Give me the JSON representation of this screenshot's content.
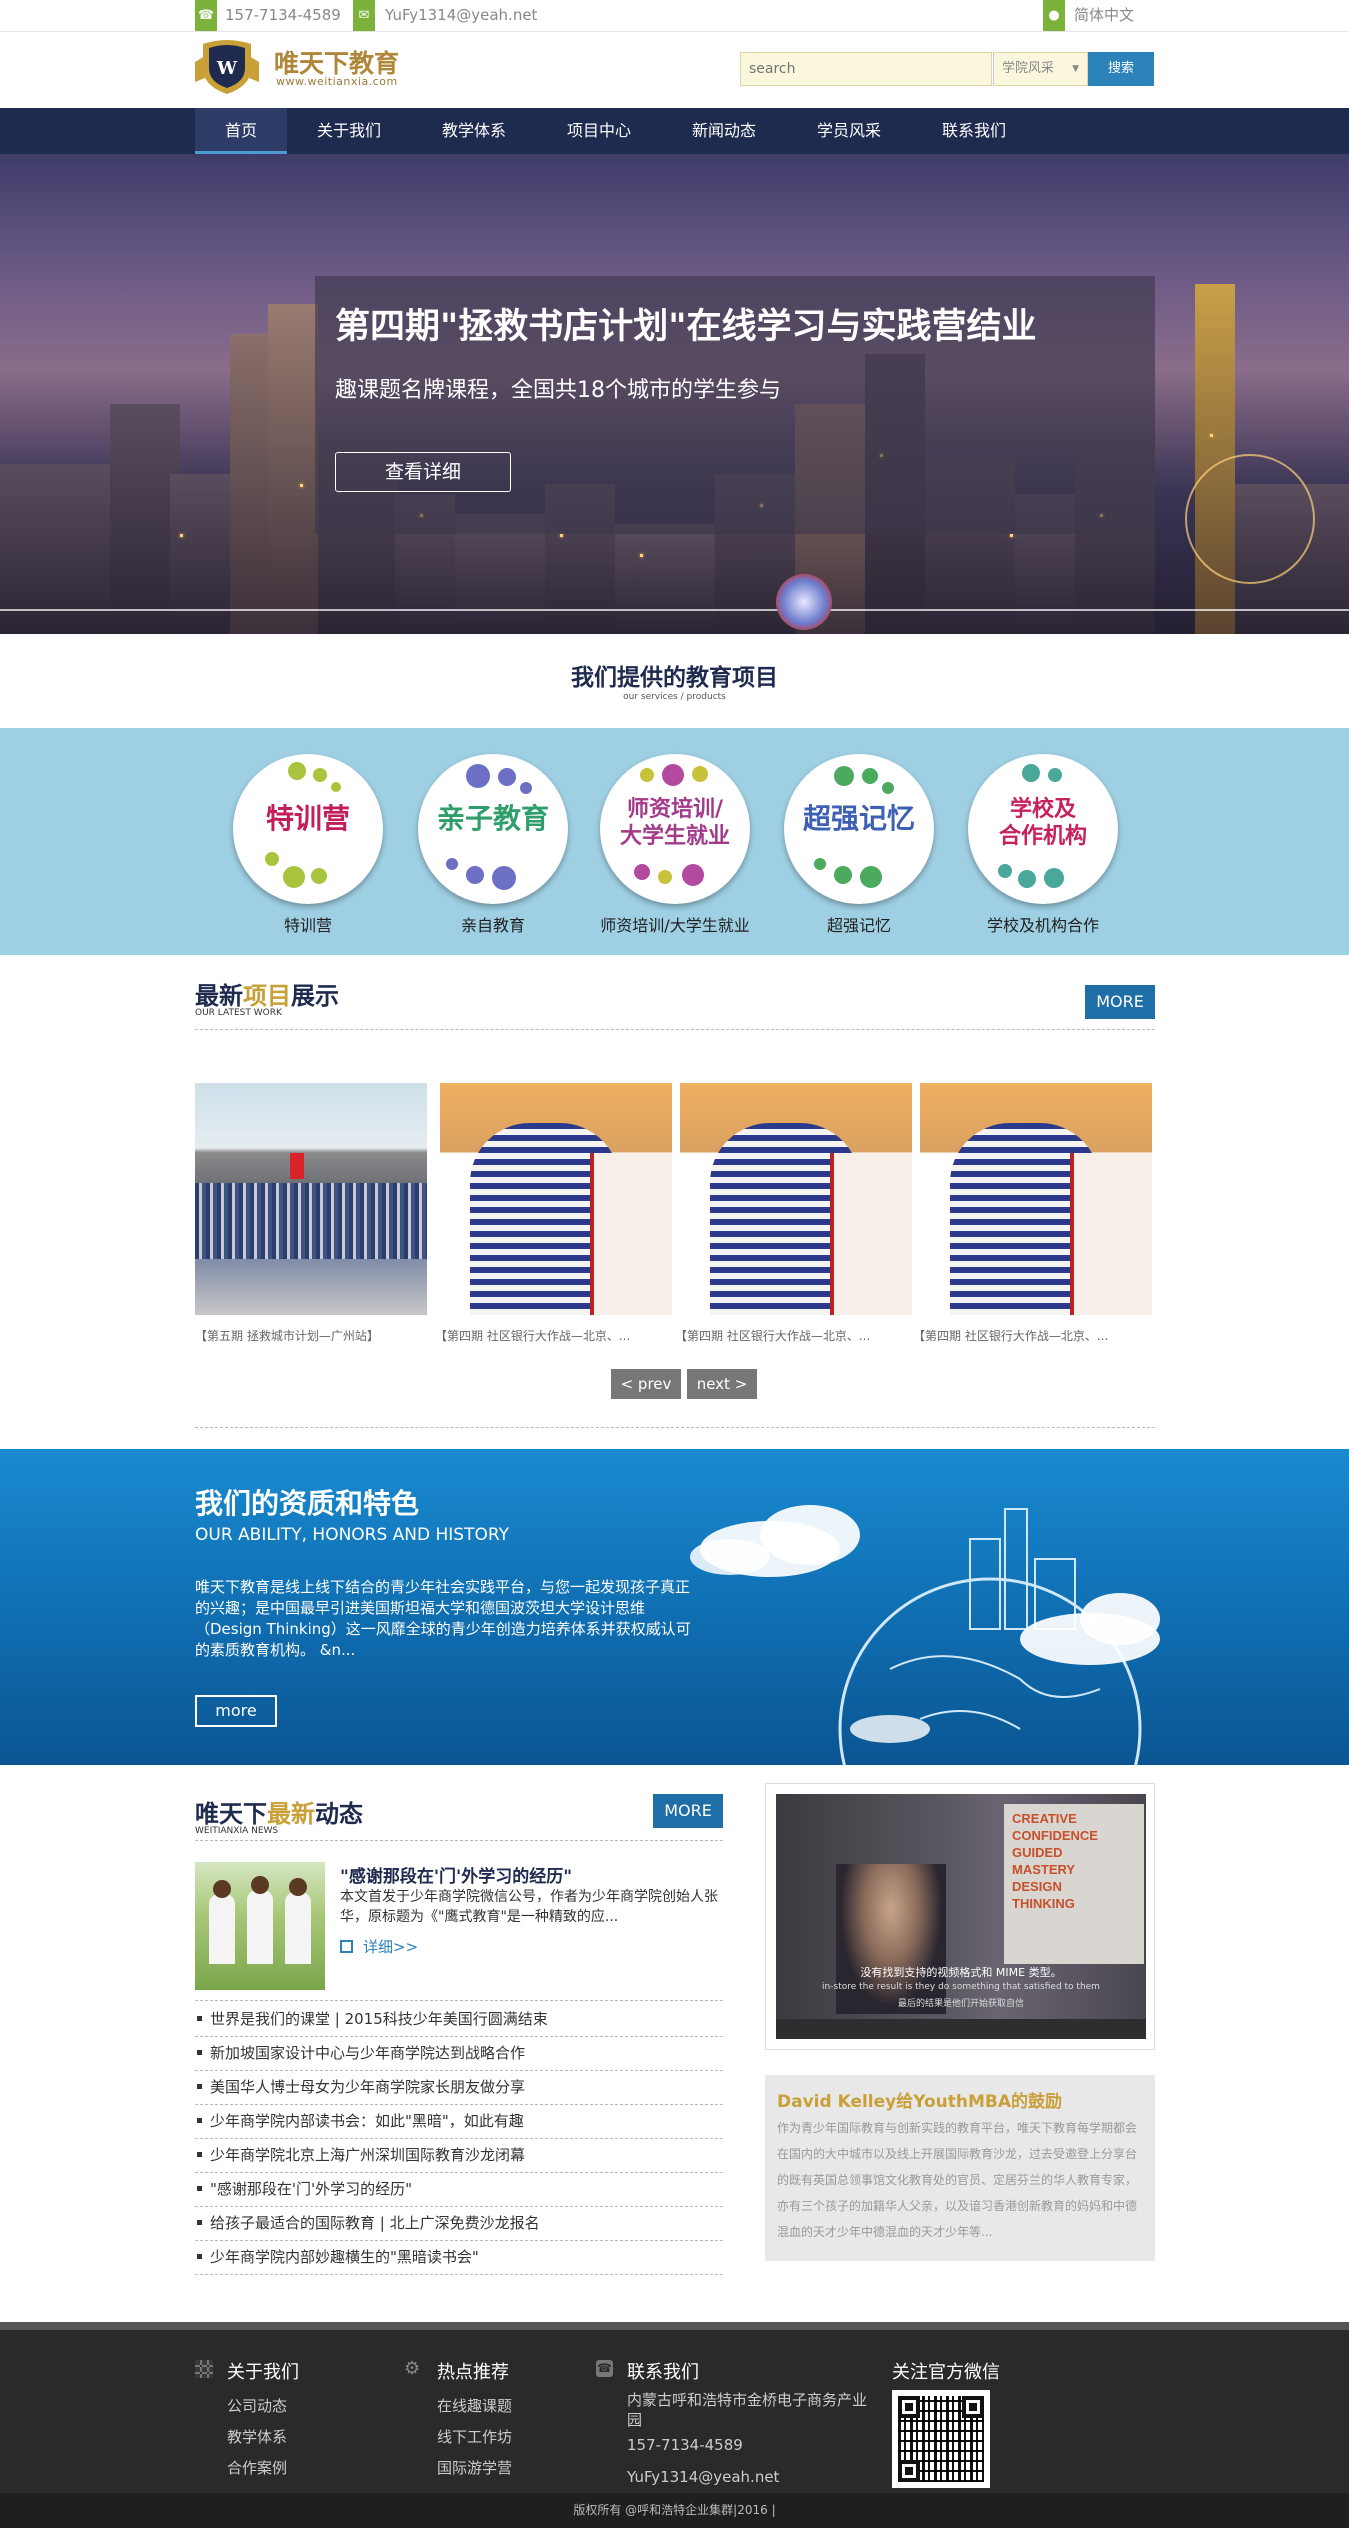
{
  "topbar": {
    "phone": "157-7134-4589",
    "email": "YuFy1314@yeah.net",
    "language": "简体中文"
  },
  "header": {
    "logo_title": "唯天下教育",
    "logo_url": "www.weitianxia.com",
    "search_placeholder": "search",
    "search_select": "学院风采",
    "search_button": "搜索"
  },
  "nav": {
    "items": [
      "首页",
      "关于我们",
      "教学体系",
      "项目中心",
      "新闻动态",
      "学员风采",
      "联系我们"
    ]
  },
  "banner": {
    "title": "第四期\"拯救书店计划\"在线学习与实践营结业",
    "subtitle": "趣课题名牌课程，全国共18个城市的学生参与",
    "button": "查看详细"
  },
  "services": {
    "title": "我们提供的教育项目",
    "subtitle": "our services / products",
    "items": [
      {
        "word": "特训营",
        "label": "特训营",
        "color": "#c21f5a",
        "dots": "#a8c43c"
      },
      {
        "word": "亲子教育",
        "label": "亲自教育",
        "color": "#2f9e6a",
        "dots": "#6c6fc4"
      },
      {
        "word1": "师资培训/",
        "word2": "大学生就业",
        "label": "师资培训/大学生就业",
        "color": "#a43a8a",
        "dots": "#b44aa0",
        "dots2": "#c8c23a"
      },
      {
        "word": "超强记忆",
        "label": "超强记忆",
        "color": "#3d5fb4",
        "dots": "#4caa5e"
      },
      {
        "word1": "学校及",
        "word2": "合作机构",
        "label": "学校及机构合作",
        "color": "#c7215c",
        "dots": "#4aa89a"
      }
    ]
  },
  "projects": {
    "title_a": "最新",
    "title_b": "项目",
    "title_c": "展示",
    "title_en": "OUR LATEST WORK",
    "more": "MORE",
    "captions": [
      "【第五期 拯救城市计划—广州站】",
      "【第四期 社区银行大作战—北京、...",
      "【第四期 社区银行大作战—北京、...",
      "【第四期 社区银行大作战—北京、..."
    ],
    "prev": "< prev",
    "next": "next >"
  },
  "ability": {
    "title": "我们的资质和特色",
    "title_en": "OUR ABILITY, HONORS AND HISTORY",
    "text": "唯天下教育是线上线下结合的青少年社会实践平台，与您一起发现孩子真正的兴趣；是中国最早引进美国斯坦福大学和德国波茨坦大学设计思维（Design Thinking）这一风靡全球的青少年创造力培养体系并获权威认可的素质教育机构。  &n...",
    "more": "more"
  },
  "news": {
    "title_a": "唯天下",
    "title_b": "最新",
    "title_c": "动态",
    "title_en": "WEITIANXIA NEWS",
    "more": "MORE",
    "featured_title": "\"感谢那段在'门'外学习的经历\"",
    "featured_text": "本文首发于少年商学院微信公号，作者为少年商学院创始人张华，原标题为《\"鹰式教育\"是一种精致的应...",
    "featured_link": "详细>>",
    "items": [
      "世界是我们的课堂 | 2015科技少年美国行圆满结束",
      "新加坡国家设计中心与少年商学院达到战略合作",
      "美国华人博士母女为少年商学院家长朋友做分享",
      "少年商学院内部读书会：如此\"黑暗\"，如此有趣",
      "少年商学院北京上海广州深圳国际教育沙龙闭幕",
      "\"感谢那段在'门'外学习的经历\"",
      "给孩子最适合的国际教育 | 北上广深免费沙龙报名",
      "少年商学院内部妙趣横生的\"黑暗读书会\""
    ]
  },
  "video": {
    "board_words": [
      "CREATIVE",
      "CONFIDENCE",
      "GUIDED",
      "MASTERY",
      "DESIGN",
      "THINKING"
    ],
    "subtitle_cn": "没有找到支持的视频格式和 MIME 类型。",
    "subtitle_en": "in-store the result is they do something that satisfied to them",
    "subtitle_cn2": "最后的结果是他们开始获取自信",
    "title": "David Kelley给YouthMBA的鼓励",
    "text": "作为青少年国际教育与创新实践的教育平台，唯天下教育每学期都会在国内的大中城市以及线上开展国际教育沙龙，过去受邀登上分享台的既有英国总领事馆文化教育处的官员、定居芬兰的华人教育专家，亦有三个孩子的加籍华人父亲，以及谙习香港创新教育的妈妈和中德混血的天才少年中德混血的天才少年等..."
  },
  "footer": {
    "about_title": "关于我们",
    "about_links": [
      "公司动态",
      "教学体系",
      "合作案例"
    ],
    "hot_title": "热点推荐",
    "hot_links": [
      "在线趣课题",
      "线下工作坊",
      "国际游学营"
    ],
    "contact_title": "联系我们",
    "address": "内蒙古呼和浩特市金桥电子商务产业园",
    "phone": "157-7134-4589",
    "email": "YuFy1314@yeah.net",
    "wechat_title": "关注官方微信",
    "copyright": "版权所有 @呼和浩特企业集群|2016 |"
  }
}
